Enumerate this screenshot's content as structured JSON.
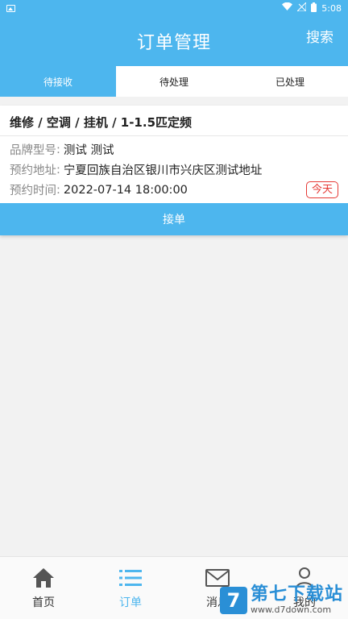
{
  "status_bar": {
    "time": "5:08"
  },
  "header": {
    "title": "订单管理",
    "search_label": "搜索"
  },
  "tabs": [
    {
      "label": "待接收",
      "active": true
    },
    {
      "label": "待处理",
      "active": false
    },
    {
      "label": "已处理",
      "active": false
    }
  ],
  "order": {
    "title": "维修 / 空调 / 挂机 / 1-1.5匹定频",
    "brand_label": "品牌型号",
    "brand_value": "测试 测试",
    "address_label": "预约地址",
    "address_value": "宁夏回族自治区银川市兴庆区测试地址",
    "time_label": "预约时间",
    "time_value": "2022-07-14 18:00:00",
    "badge": "今天",
    "accept_label": "接单",
    "separator": ":"
  },
  "bottom_nav": [
    {
      "label": "首页",
      "icon": "home-icon"
    },
    {
      "label": "订单",
      "icon": "list-icon",
      "active": true
    },
    {
      "label": "消息",
      "icon": "mail-icon"
    },
    {
      "label": "我的",
      "icon": "user-icon"
    }
  ],
  "watermark": {
    "logo": "7",
    "main": "第七下载站",
    "sub": "www.d7down.com"
  },
  "colors": {
    "accent": "#4db6ee",
    "badge": "#e53935",
    "watermark": "#2a8fd6"
  }
}
